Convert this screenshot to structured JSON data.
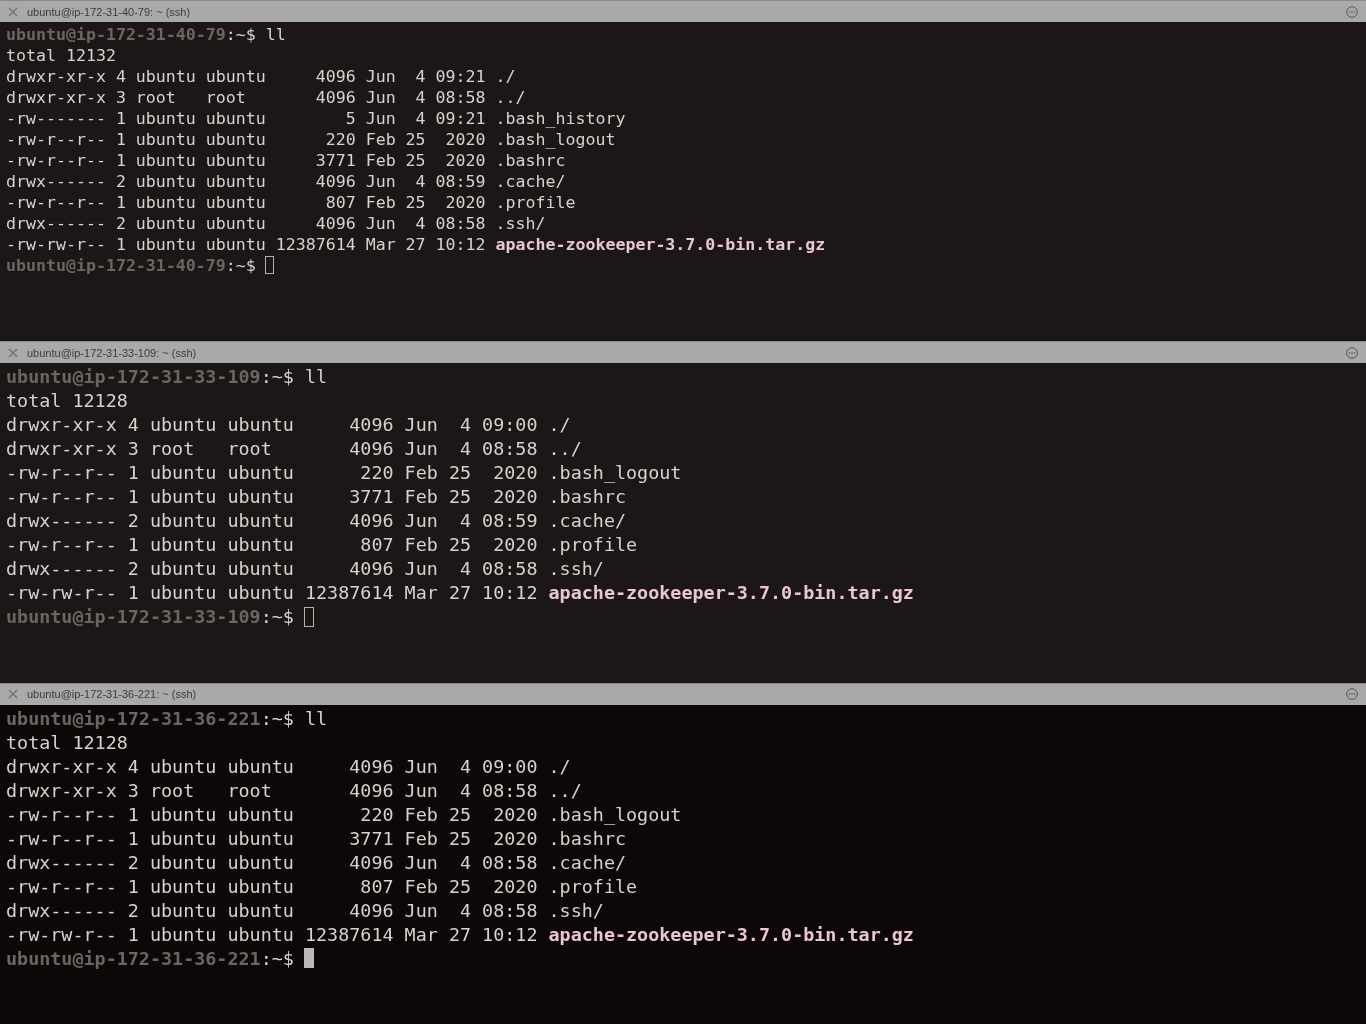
{
  "panes": [
    {
      "title": "ubuntu@ip-172-31-40-79: ~ (ssh)",
      "focused": false,
      "prompt": "ubuntu@ip-172-31-40-79",
      "command": ":~$ ll",
      "lines": [
        {
          "text": "total 12132"
        },
        {
          "text": "drwxr-xr-x 4 ubuntu ubuntu     4096 Jun  4 09:21 ./"
        },
        {
          "text": "drwxr-xr-x 3 root   root       4096 Jun  4 08:58 ../"
        },
        {
          "text": "-rw------- 1 ubuntu ubuntu        5 Jun  4 09:21 .bash_history"
        },
        {
          "text": "-rw-r--r-- 1 ubuntu ubuntu      220 Feb 25  2020 .bash_logout"
        },
        {
          "text": "-rw-r--r-- 1 ubuntu ubuntu     3771 Feb 25  2020 .bashrc"
        },
        {
          "text": "drwx------ 2 ubuntu ubuntu     4096 Jun  4 08:59 .cache/"
        },
        {
          "text": "-rw-r--r-- 1 ubuntu ubuntu      807 Feb 25  2020 .profile"
        },
        {
          "text": "drwx------ 2 ubuntu ubuntu     4096 Jun  4 08:58 .ssh/"
        },
        {
          "text": "-rw-rw-r-- 1 ubuntu ubuntu 12387614 Mar 27 10:12 **apache-zookeeper-3.7.0-bin.tar.gz**"
        }
      ],
      "final_prompt": "ubuntu@ip-172-31-40-79",
      "final_command": ":~$"
    },
    {
      "title": "ubuntu@ip-172-31-33-109: ~ (ssh)",
      "focused": false,
      "prompt": "ubuntu@ip-172-31-33-109",
      "command": ":~$ ll",
      "lines": [
        {
          "text": "total 12128"
        },
        {
          "text": "drwxr-xr-x 4 ubuntu ubuntu     4096 Jun  4 09:00 ./"
        },
        {
          "text": "drwxr-xr-x 3 root   root       4096 Jun  4 08:58 ../"
        },
        {
          "text": "-rw-r--r-- 1 ubuntu ubuntu      220 Feb 25  2020 .bash_logout"
        },
        {
          "text": "-rw-r--r-- 1 ubuntu ubuntu     3771 Feb 25  2020 .bashrc"
        },
        {
          "text": "drwx------ 2 ubuntu ubuntu     4096 Jun  4 08:59 .cache/"
        },
        {
          "text": "-rw-r--r-- 1 ubuntu ubuntu      807 Feb 25  2020 .profile"
        },
        {
          "text": "drwx------ 2 ubuntu ubuntu     4096 Jun  4 08:58 .ssh/"
        },
        {
          "text": "-rw-rw-r-- 1 ubuntu ubuntu 12387614 Mar 27 10:12 **apache-zookeeper-3.7.0-bin.tar.gz**"
        }
      ],
      "final_prompt": "ubuntu@ip-172-31-33-109",
      "final_command": ":~$"
    },
    {
      "title": "ubuntu@ip-172-31-36-221: ~ (ssh)",
      "focused": true,
      "prompt": "ubuntu@ip-172-31-36-221",
      "command": ":~$ ll",
      "lines": [
        {
          "text": "total 12128"
        },
        {
          "text": "drwxr-xr-x 4 ubuntu ubuntu     4096 Jun  4 09:00 ./"
        },
        {
          "text": "drwxr-xr-x 3 root   root       4096 Jun  4 08:58 ../"
        },
        {
          "text": "-rw-r--r-- 1 ubuntu ubuntu      220 Feb 25  2020 .bash_logout"
        },
        {
          "text": "-rw-r--r-- 1 ubuntu ubuntu     3771 Feb 25  2020 .bashrc"
        },
        {
          "text": "drwx------ 2 ubuntu ubuntu     4096 Jun  4 08:58 .cache/"
        },
        {
          "text": "-rw-r--r-- 1 ubuntu ubuntu      807 Feb 25  2020 .profile"
        },
        {
          "text": "drwx------ 2 ubuntu ubuntu     4096 Jun  4 08:58 .ssh/"
        },
        {
          "text": "-rw-rw-r-- 1 ubuntu ubuntu 12387614 Mar 27 10:12 **apache-zookeeper-3.7.0-bin.tar.gz**"
        }
      ],
      "final_prompt": "ubuntu@ip-172-31-36-221",
      "final_command": ":~$"
    }
  ]
}
